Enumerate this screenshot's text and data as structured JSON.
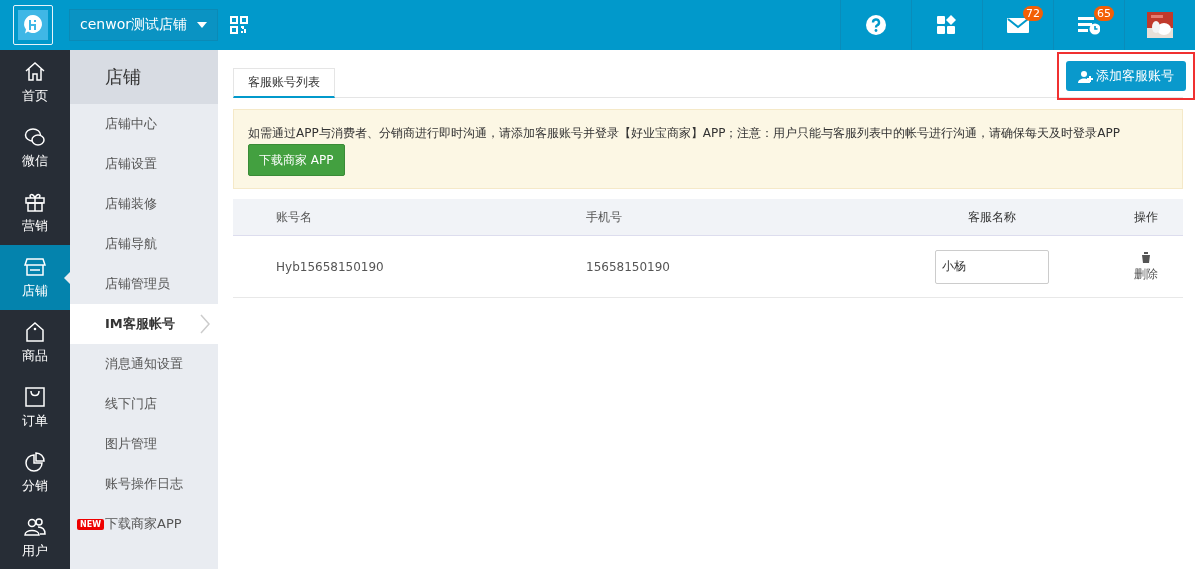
{
  "topbar": {
    "store_name": "cenwor测试店铺",
    "icons": [
      {
        "kind": "help"
      },
      {
        "kind": "apps"
      },
      {
        "kind": "mail",
        "badge": "72"
      },
      {
        "kind": "tasks",
        "badge": "65"
      },
      {
        "kind": "avatar"
      }
    ]
  },
  "nav": [
    {
      "label": "首页",
      "kind": "home",
      "selected": false
    },
    {
      "label": "微信",
      "kind": "wechat",
      "selected": false
    },
    {
      "label": "营销",
      "kind": "gift",
      "selected": false
    },
    {
      "label": "店铺",
      "kind": "store",
      "selected": true
    },
    {
      "label": "商品",
      "kind": "tag",
      "selected": false
    },
    {
      "label": "订单",
      "kind": "bag",
      "selected": false
    },
    {
      "label": "分销",
      "kind": "pie",
      "selected": false
    },
    {
      "label": "用户",
      "kind": "users",
      "selected": false
    }
  ],
  "subnav": {
    "title": "店铺",
    "items": [
      {
        "label": "店铺中心",
        "selected": false
      },
      {
        "label": "店铺设置",
        "selected": false
      },
      {
        "label": "店铺装修",
        "selected": false
      },
      {
        "label": "店铺导航",
        "selected": false
      },
      {
        "label": "店铺管理员",
        "selected": false
      },
      {
        "label": "IM客服帐号",
        "selected": true
      },
      {
        "label": "消息通知设置",
        "selected": false
      },
      {
        "label": "线下门店",
        "selected": false
      },
      {
        "label": "图片管理",
        "selected": false
      },
      {
        "label": "账号操作日志",
        "selected": false
      },
      {
        "label": "下载商家APP",
        "selected": false,
        "badge": "NEW"
      }
    ]
  },
  "tabs": [
    {
      "label": "客服账号列表",
      "selected": true
    }
  ],
  "add_button": {
    "label": "添加客服账号",
    "highlighted": true
  },
  "notice": {
    "text": "如需通过APP与消费者、分销商进行即时沟通，请添加客服账号并登录【好业宝商家】APP；注意：用户只能与客服列表中的帐号进行沟通，请确保每天及时登录APP",
    "button": "下载商家 APP"
  },
  "table": {
    "columns": [
      "账号名",
      "手机号",
      "客服名称",
      "操作"
    ],
    "rows": [
      {
        "account": "Hyb15658150190",
        "phone": "15658150190",
        "name": "小杨",
        "action": "删除"
      }
    ]
  }
}
